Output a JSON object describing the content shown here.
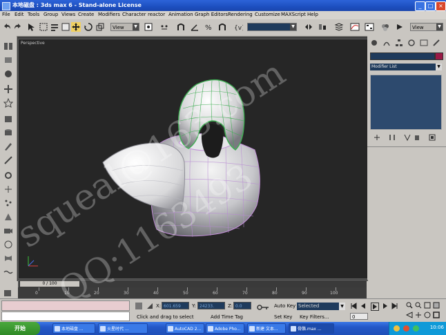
{
  "window": {
    "title": "本地磁盘 : 3ds max 6 - Stand-alone License",
    "buttons": [
      "minimize-icon",
      "maximize-icon",
      "close-icon"
    ]
  },
  "menu": [
    "File",
    "Edit",
    "Tools",
    "Group",
    "Views",
    "Create",
    "Modifiers",
    "Character",
    "reactor",
    "Animation",
    "Graph Editors",
    "Rendering",
    "Customize",
    "MAXScript",
    "Help"
  ],
  "toolbar": {
    "ref_coord": "View",
    "ref_coord2": "View",
    "named_selection": ""
  },
  "viewport": {
    "label": "Perspective"
  },
  "command_panel": {
    "modifier_list": "Modifier List",
    "object_color": "#9a1a46"
  },
  "timeline": {
    "slider_label": "0 / 100",
    "ticks": [
      "0",
      "10",
      "20",
      "30",
      "40",
      "50",
      "60",
      "70",
      "80",
      "90",
      "100"
    ]
  },
  "status": {
    "x_label": "X:",
    "x_value": "601.659",
    "y_label": "Y:",
    "y_value": "24233.",
    "z_label": "Z:",
    "z_value": "0.0",
    "prompt": "Click and drag to select",
    "add_time_tag": "Add Time Tag",
    "auto_key": "Auto Key",
    "set_key": "Set Key",
    "key_filters": "Key Filters...",
    "selection_mode": "Selected",
    "frame": "0"
  },
  "taskbar": {
    "start": "开始",
    "items": [
      "本地磁盘 ...",
      "火星时代 ...",
      "AutoCAD 2...",
      "Adobe Pho...",
      "新建 文本...",
      "骨骼.max ..."
    ],
    "clock": "10:06"
  },
  "watermark": {
    "line1": "squeal@163.com",
    "line2": "QQ:1163493"
  },
  "colors": {
    "accent": "#2d63d8",
    "viewport_bg": "#262626",
    "wireframe_helmet": "#3fae53",
    "wireframe_body": "#b98bd4"
  }
}
